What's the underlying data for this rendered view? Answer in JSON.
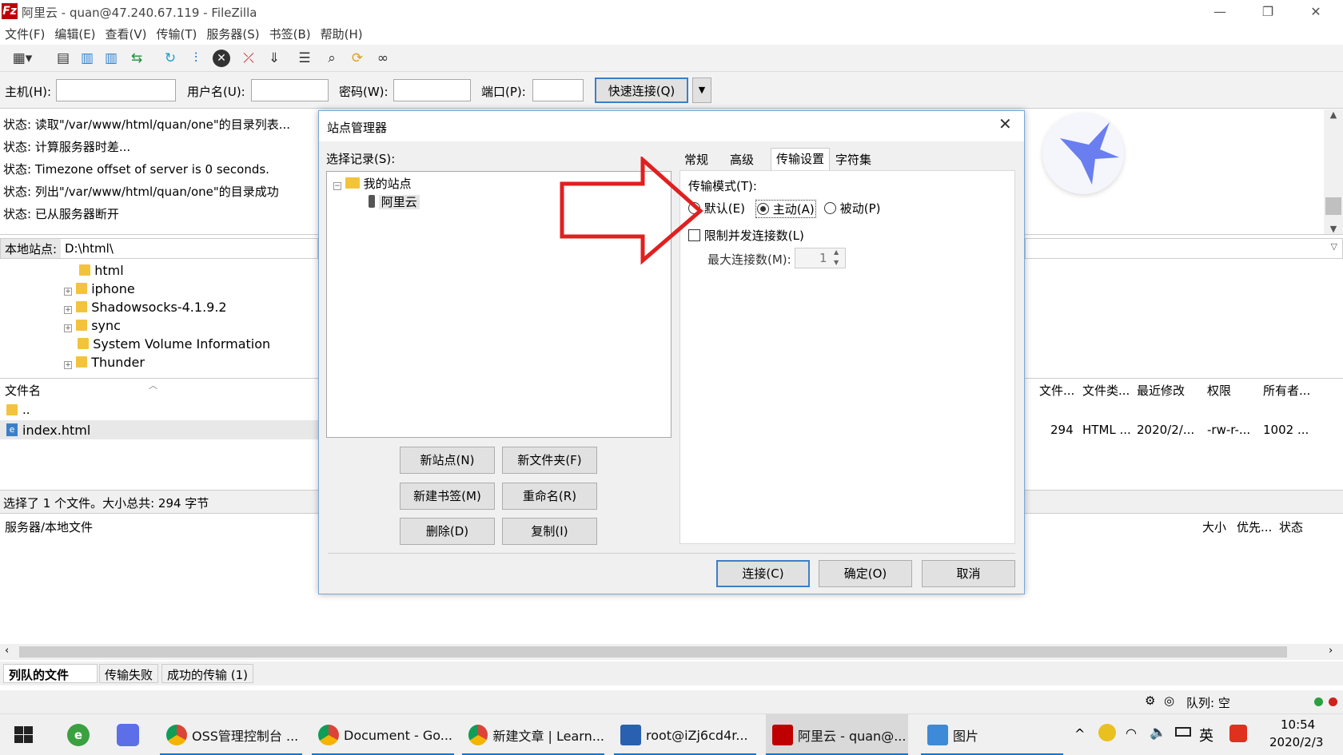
{
  "window": {
    "title": "阿里云 - quan@47.240.67.119 - FileZilla",
    "app_icon": "Fz"
  },
  "menu": [
    "文件(F)",
    "编辑(E)",
    "查看(V)",
    "传输(T)",
    "服务器(S)",
    "书签(B)",
    "帮助(H)"
  ],
  "quickconnect": {
    "host_label": "主机(H):",
    "user_label": "用户名(U):",
    "pass_label": "密码(W):",
    "port_label": "端口(P):",
    "button": "快速连接(Q)"
  },
  "log": [
    {
      "label": "状态:",
      "text": "读取\"/var/www/html/quan/one\"的目录列表..."
    },
    {
      "label": "状态:",
      "text": "计算服务器时差..."
    },
    {
      "label": "状态:",
      "text": "Timezone offset of server is 0 seconds."
    },
    {
      "label": "状态:",
      "text": "列出\"/var/www/html/quan/one\"的目录成功"
    },
    {
      "label": "状态:",
      "text": "已从服务器断开"
    }
  ],
  "local": {
    "site_label": "本地站点:",
    "site_path": "D:\\html\\",
    "tree": [
      "html",
      "iphone",
      "Shadowsocks-4.1.9.2",
      "sync",
      "System Volume Information",
      "Thunder"
    ],
    "filename_header": "文件名",
    "files": [
      "..",
      "index.html"
    ],
    "status": "选择了 1 个文件。大小总共: 294 字节"
  },
  "remote": {
    "headers": [
      "文件...",
      "文件类...",
      "最近修改",
      "权限",
      "所有者..."
    ],
    "row": [
      "294",
      "HTML ...",
      "2020/2/...",
      "-rw-r-...",
      "1002 ..."
    ]
  },
  "queue": {
    "col_server": "服务器/本地文件",
    "cols_right": [
      "大小",
      "优先...",
      "状态"
    ],
    "tabs": [
      "列队的文件",
      "传输失败",
      "成功的传输 (1)"
    ],
    "status": "队列: 空"
  },
  "dialog": {
    "title": "站点管理器",
    "select_label": "选择记录(S):",
    "tree_root": "我的站点",
    "tree_child": "阿里云",
    "buttons": [
      "新站点(N)",
      "新文件夹(F)",
      "新建书签(M)",
      "重命名(R)",
      "删除(D)",
      "复制(I)"
    ],
    "tabs": [
      "常规",
      "高级",
      "传输设置",
      "字符集"
    ],
    "mode_label": "传输模式(T):",
    "modes": [
      "默认(E)",
      "主动(A)",
      "被动(P)"
    ],
    "limit_label": "限制并发连接数(L)",
    "max_label": "最大连接数(M):",
    "max_value": "1",
    "footer": [
      "连接(C)",
      "确定(O)",
      "取消"
    ]
  },
  "taskbar": {
    "items": [
      "OSS管理控制台 ...",
      "Document - Go...",
      "新建文章 | Learn...",
      "root@iZj6cd4r...",
      "阿里云 - quan@...",
      "图片"
    ],
    "ime": "英",
    "time": "10:54",
    "date": "2020/2/3"
  },
  "colors": {
    "accent": "#0078d7",
    "arrow": "#e02020",
    "filezilla": "#bf0000"
  }
}
